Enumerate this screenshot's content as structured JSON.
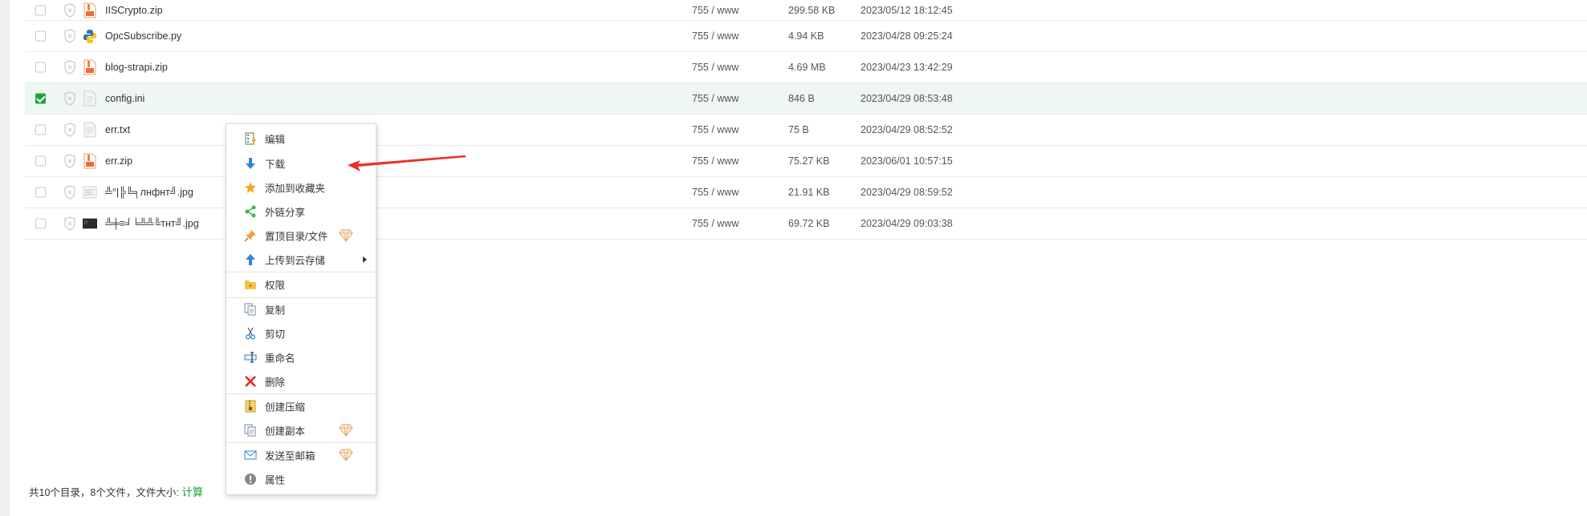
{
  "files": [
    {
      "name": "IISCrypto.zip",
      "perm": "755 / www",
      "size": "299.58 KB",
      "date": "2023/05/12 18:12:45",
      "icon": "zip-file-icon",
      "checked": false
    },
    {
      "name": "OpcSubscribe.py",
      "perm": "755 / www",
      "size": "4.94 KB",
      "date": "2023/04/28 09:25:24",
      "icon": "python-file-icon",
      "checked": false
    },
    {
      "name": "blog-strapi.zip",
      "perm": "755 / www",
      "size": "4.69 MB",
      "date": "2023/04/23 13:42:29",
      "icon": "zip-file-icon",
      "checked": false
    },
    {
      "name": "config.ini",
      "perm": "755 / www",
      "size": "846 B",
      "date": "2023/04/29 08:53:48",
      "icon": "text-file-icon",
      "checked": true
    },
    {
      "name": "err.txt",
      "perm": "755 / www",
      "size": "75 B",
      "date": "2023/04/29 08:52:52",
      "icon": "text-file-icon",
      "checked": false
    },
    {
      "name": "err.zip",
      "perm": "755 / www",
      "size": "75.27 KB",
      "date": "2023/06/01 10:57:15",
      "icon": "zip-file-icon",
      "checked": false
    },
    {
      "name": "╩°|╠╚╕лнфнт╝.jpg",
      "perm": "755 / www",
      "size": "21.91 KB",
      "date": "2023/04/29 08:59:52",
      "icon": "image-thumbnail-icon",
      "checked": false
    },
    {
      "name": "╩╪≡╛╘╩╩╚тнт╝.jpg",
      "perm": "755 / www",
      "size": "69.72 KB",
      "date": "2023/04/29 09:03:38",
      "icon": "image-thumbnail-dark-icon",
      "checked": false
    }
  ],
  "summary": {
    "text": "共10个目录，8个文件，文件大小: ",
    "calc_link": "计算"
  },
  "context_menu": {
    "edit": "编辑",
    "download": "下载",
    "favorite": "添加到收藏夹",
    "share": "外链分享",
    "pin": "置顶目录/文件",
    "upload_cloud": "上传到云存储",
    "permission": "权限",
    "copy": "复制",
    "cut": "剪切",
    "rename": "重命名",
    "delete": "删除",
    "compress": "创建压缩",
    "duplicate": "创建副本",
    "email": "发送至邮箱",
    "properties": "属性"
  },
  "colors": {
    "accent_green": "#20a53a",
    "selected_row": "#eef7f2",
    "arrow_red": "#e8312a"
  }
}
